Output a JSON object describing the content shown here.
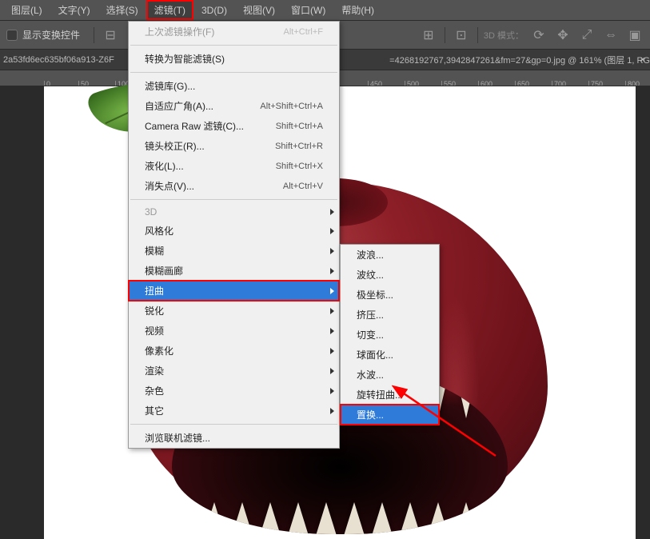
{
  "menubar": {
    "items": [
      "图层(L)",
      "文字(Y)",
      "选择(S)",
      "滤镜(T)",
      "3D(D)",
      "视图(V)",
      "窗口(W)",
      "帮助(H)"
    ],
    "active_index": 3
  },
  "toolbar": {
    "checkbox_label": "显示变换控件",
    "mode3d_label": "3D 模式："
  },
  "tab": {
    "title_left": "2a53fd6ec635bf06a913-Z6F",
    "title_right": "=4268192767,3942847261&fm=27&gp=0.jpg @ 161% (图层 1, RG"
  },
  "ruler": {
    "ticks": [
      "0",
      "50",
      "100",
      "450",
      "500",
      "550",
      "600",
      "650",
      "700",
      "750",
      "800"
    ]
  },
  "dropdown1": {
    "groups": [
      [
        {
          "label": "上次滤镜操作(F)",
          "kbd": "Alt+Ctrl+F",
          "disabled": true
        }
      ],
      [
        {
          "label": "转换为智能滤镜(S)"
        }
      ],
      [
        {
          "label": "滤镜库(G)..."
        },
        {
          "label": "自适应广角(A)...",
          "kbd": "Alt+Shift+Ctrl+A"
        },
        {
          "label": "Camera Raw 滤镜(C)...",
          "kbd": "Shift+Ctrl+A"
        },
        {
          "label": "镜头校正(R)...",
          "kbd": "Shift+Ctrl+R"
        },
        {
          "label": "液化(L)...",
          "kbd": "Shift+Ctrl+X"
        },
        {
          "label": "消失点(V)...",
          "kbd": "Alt+Ctrl+V"
        }
      ],
      [
        {
          "label": "3D",
          "sub": true,
          "disabled": true
        },
        {
          "label": "风格化",
          "sub": true
        },
        {
          "label": "模糊",
          "sub": true
        },
        {
          "label": "模糊画廊",
          "sub": true
        },
        {
          "label": "扭曲",
          "sub": true,
          "highlight": true,
          "redbox": true
        },
        {
          "label": "锐化",
          "sub": true
        },
        {
          "label": "视频",
          "sub": true
        },
        {
          "label": "像素化",
          "sub": true
        },
        {
          "label": "渲染",
          "sub": true
        },
        {
          "label": "杂色",
          "sub": true
        },
        {
          "label": "其它",
          "sub": true
        }
      ],
      [
        {
          "label": "浏览联机滤镜..."
        }
      ]
    ]
  },
  "dropdown2": {
    "items": [
      {
        "label": "波浪..."
      },
      {
        "label": "波纹..."
      },
      {
        "label": "极坐标..."
      },
      {
        "label": "挤压..."
      },
      {
        "label": "切变..."
      },
      {
        "label": "球面化..."
      },
      {
        "label": "水波..."
      },
      {
        "label": "旋转扭曲..."
      },
      {
        "label": "置换...",
        "highlight": true,
        "redbox": true
      }
    ]
  }
}
